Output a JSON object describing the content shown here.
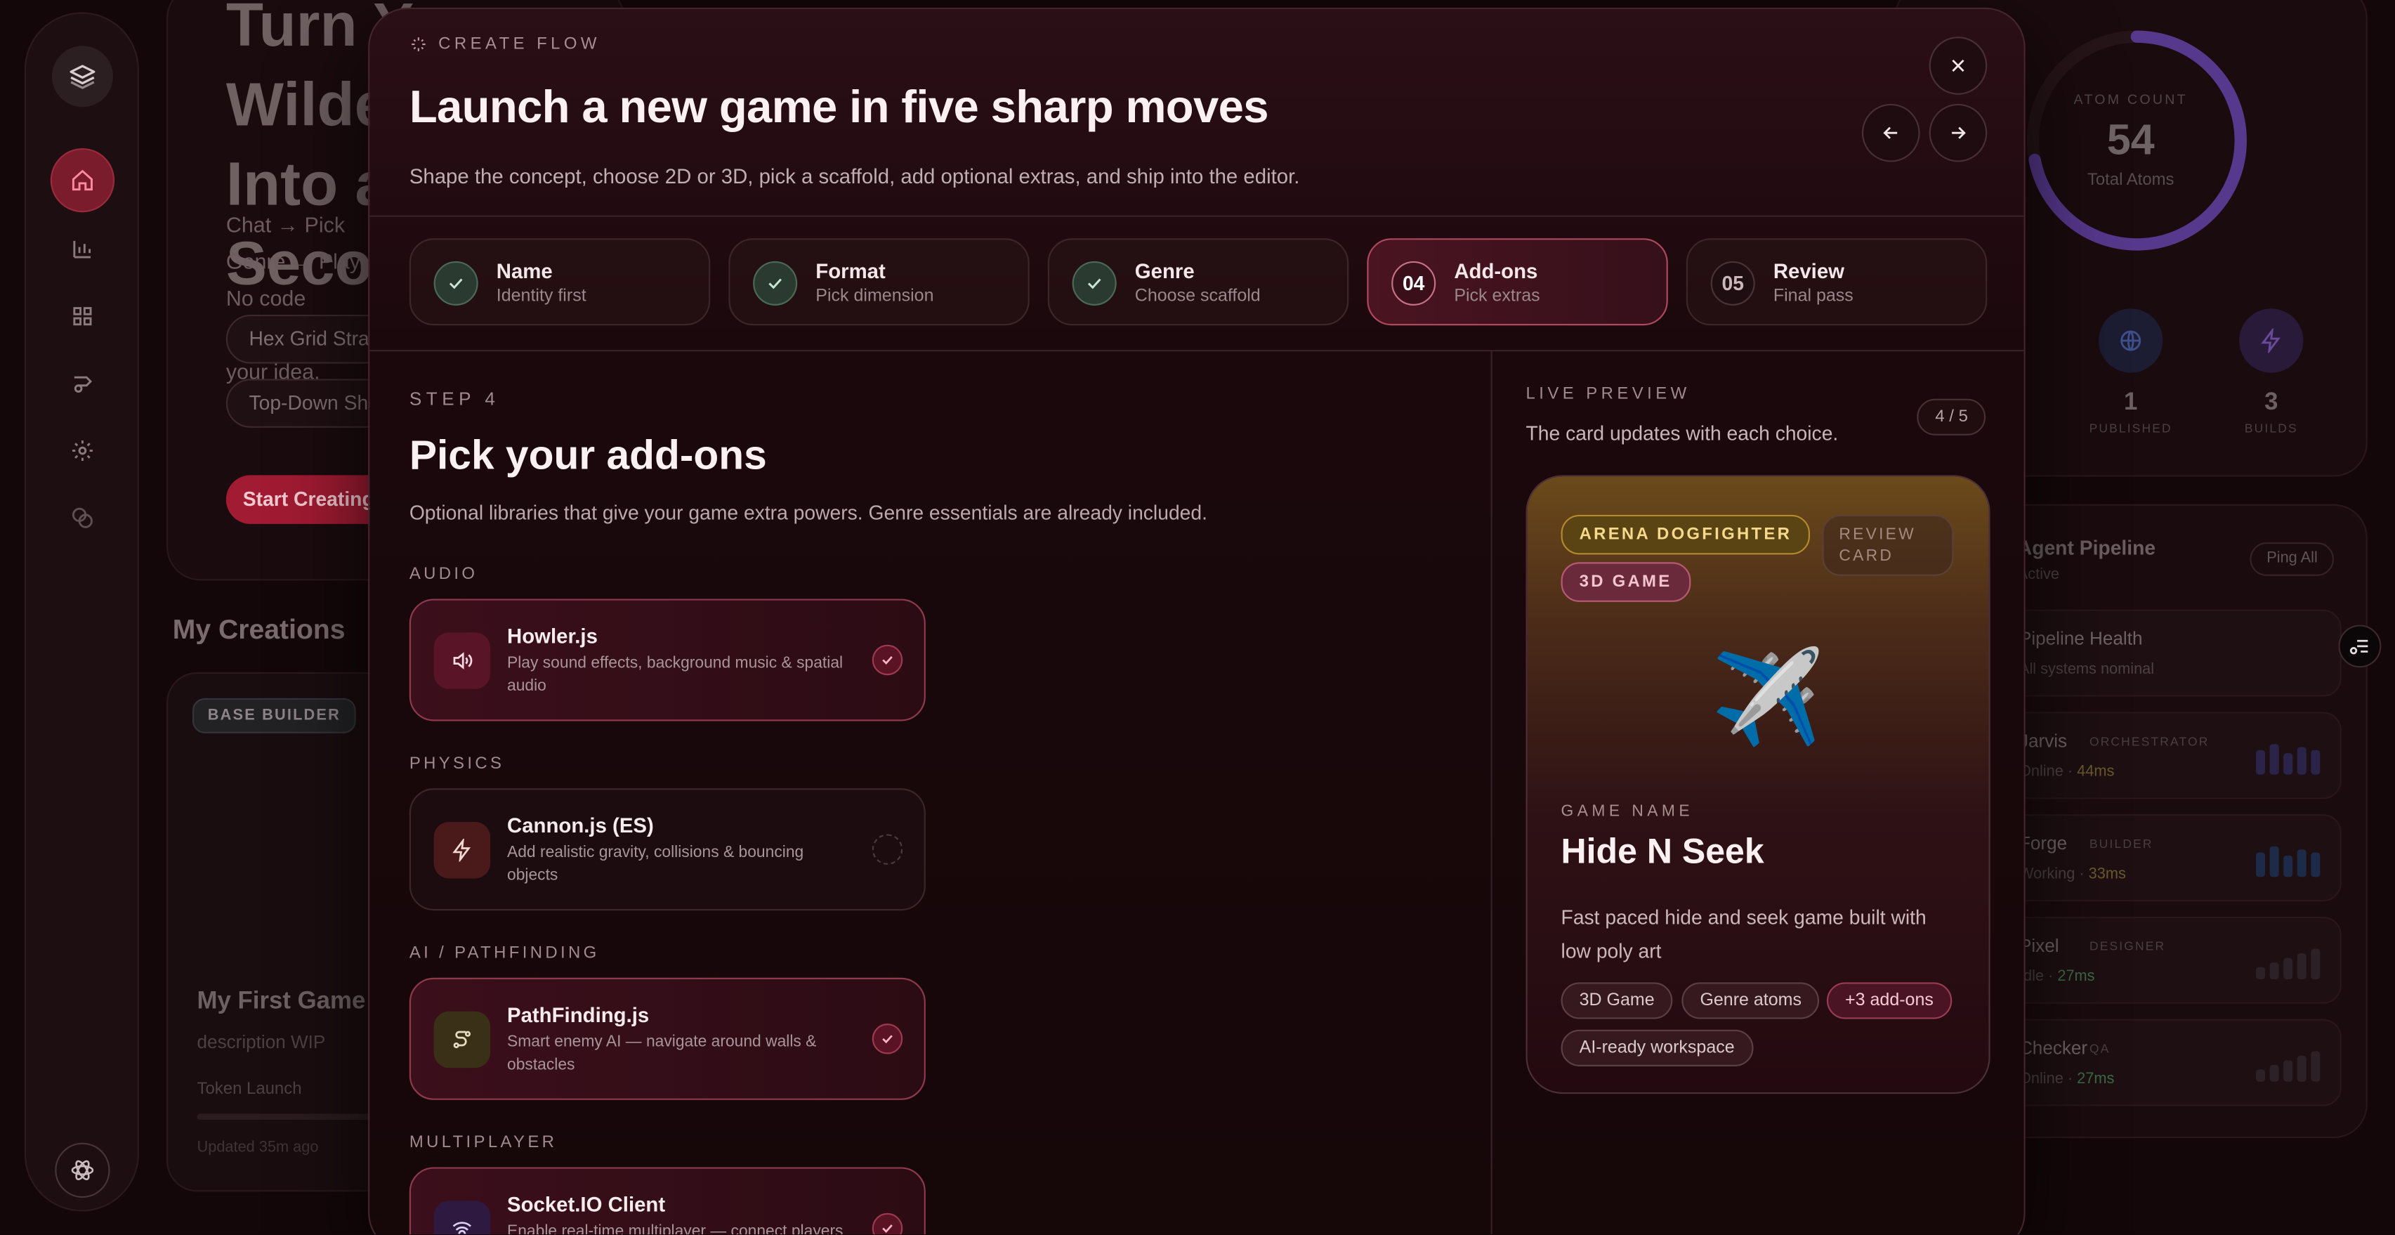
{
  "background": {
    "hero_title": "Turn Your Wildest Idea Into a Game in Seconds",
    "hero_sub": "Chat → Pick Genre → Play. No code required, just your idea.",
    "pill_1": "Hex Grid Strategy",
    "pill_2": "Top-Down Shooter",
    "start_button": "Start Creating",
    "my_creations": "My Creations",
    "game_card": {
      "badge": "BASE BUILDER",
      "title": "My First Game",
      "desc": "description WIP",
      "token": "Token Launch",
      "updated": "Updated 35m ago"
    },
    "atom_count_label": "ATOM COUNT",
    "atom_count_value": "54",
    "atom_count_sub": "Total Atoms",
    "atom_ratio": 0.72,
    "stats": [
      {
        "value": "1",
        "label": "PUBLISHED"
      },
      {
        "value": "3",
        "label": "BUILDS"
      }
    ],
    "pipeline": {
      "title": "Agent Pipeline",
      "sub": "Active",
      "ping": "Ping All",
      "rows": [
        {
          "name": "Pipeline Health",
          "role": "",
          "status": "All systems nominal",
          "time": ""
        },
        {
          "name": "Jarvis",
          "role": "ORCHESTRATOR",
          "status": "Online",
          "time": "44ms"
        },
        {
          "name": "Forge",
          "role": "BUILDER",
          "status": "Working",
          "time": "33ms"
        },
        {
          "name": "Pixel",
          "role": "DESIGNER",
          "status": "Idle",
          "time": "27ms"
        },
        {
          "name": "Checker",
          "role": "QA",
          "status": "Online",
          "time": "27ms"
        }
      ]
    }
  },
  "modal": {
    "eyebrow": "CREATE FLOW",
    "title": "Launch a new game in five sharp moves",
    "subtitle": "Shape the concept, choose 2D or 3D, pick a scaffold, add optional extras, and ship into the editor.",
    "steps": [
      {
        "num": "",
        "title": "Name",
        "sub": "Identity first",
        "state": "done"
      },
      {
        "num": "",
        "title": "Format",
        "sub": "Pick dimension",
        "state": "done"
      },
      {
        "num": "",
        "title": "Genre",
        "sub": "Choose scaffold",
        "state": "done"
      },
      {
        "num": "04",
        "title": "Add-ons",
        "sub": "Pick extras",
        "state": "active"
      },
      {
        "num": "05",
        "title": "Review",
        "sub": "Final pass",
        "state": "pending"
      }
    ],
    "step_label": "STEP 4",
    "step_title": "Pick your add-ons",
    "step_sub": "Optional libraries that give your game extra powers. Genre essentials are already included.",
    "categories": [
      {
        "label": "AUDIO",
        "addon": {
          "name": "Howler.js",
          "desc": "Play sound effects, background music & spatial audio",
          "selected": true,
          "icon": "speaker-icon"
        }
      },
      {
        "label": "PHYSICS",
        "addon": {
          "name": "Cannon.js (ES)",
          "desc": "Add realistic gravity, collisions & bouncing objects",
          "selected": false,
          "icon": "bolt-icon"
        }
      },
      {
        "label": "AI / PATHFINDING",
        "addon": {
          "name": "PathFinding.js",
          "desc": "Smart enemy AI — navigate around walls & obstacles",
          "selected": true,
          "icon": "route-icon"
        }
      },
      {
        "label": "MULTIPLAYER",
        "addon": {
          "name": "Socket.IO Client",
          "desc": "Enable real-time multiplayer — connect players",
          "selected": true,
          "icon": "wifi-icon"
        }
      }
    ],
    "preview": {
      "label": "LIVE PREVIEW",
      "sub": "The card updates with each choice.",
      "count": "4 / 5",
      "tag_genre": "ARENA DOGFIGHTER",
      "tag_review": "REVIEW CARD",
      "tag_format": "3D GAME",
      "emoji": "✈️",
      "name_label": "GAME NAME",
      "name": "Hide N Seek",
      "desc": "Fast paced hide and seek game built with low poly art",
      "chips": [
        "3D Game",
        "Genre atoms",
        "+3 add-ons",
        "AI-ready workspace"
      ]
    }
  },
  "colors": {
    "accent": "#a11b32",
    "gold": "#b58a2c",
    "done": "#4a6a55"
  }
}
